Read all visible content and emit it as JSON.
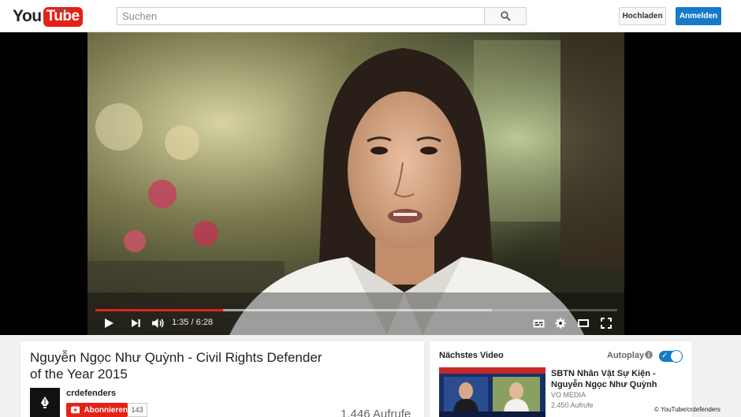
{
  "masthead": {
    "logo_you": "You",
    "logo_tube": "Tube",
    "region": "DE",
    "search_placeholder": "Suchen",
    "upload_label": "Hochladen",
    "signin_label": "Anmelden"
  },
  "player": {
    "current_time": "1:35",
    "time_separator": "/",
    "duration": "6:28",
    "played_fraction": 0.245,
    "buffered_fraction": 0.76,
    "accent_color": "#e62117"
  },
  "video": {
    "title": "Nguyễn Ngọc Như Quỳnh - Civil Rights Defender of the Year 2015",
    "channel": "crdefenders",
    "subscribe_label": "Abonnieren",
    "subscriber_count": "143",
    "view_count": "1.446 Aufrufe"
  },
  "sidebar": {
    "heading": "Nächstes Video",
    "autoplay_label": "Autoplay",
    "autoplay_on": true,
    "next_video": {
      "title": "SBTN Nhân Vật Sự Kiện - Nguyễn Ngọc Như Quỳnh",
      "channel": "VO MEDIA",
      "views": "2.450 Aufrufe"
    }
  },
  "watermark": "© YouTube/crdefenders",
  "colors": {
    "brand_red": "#e62117",
    "signin_blue": "#167ac6"
  }
}
